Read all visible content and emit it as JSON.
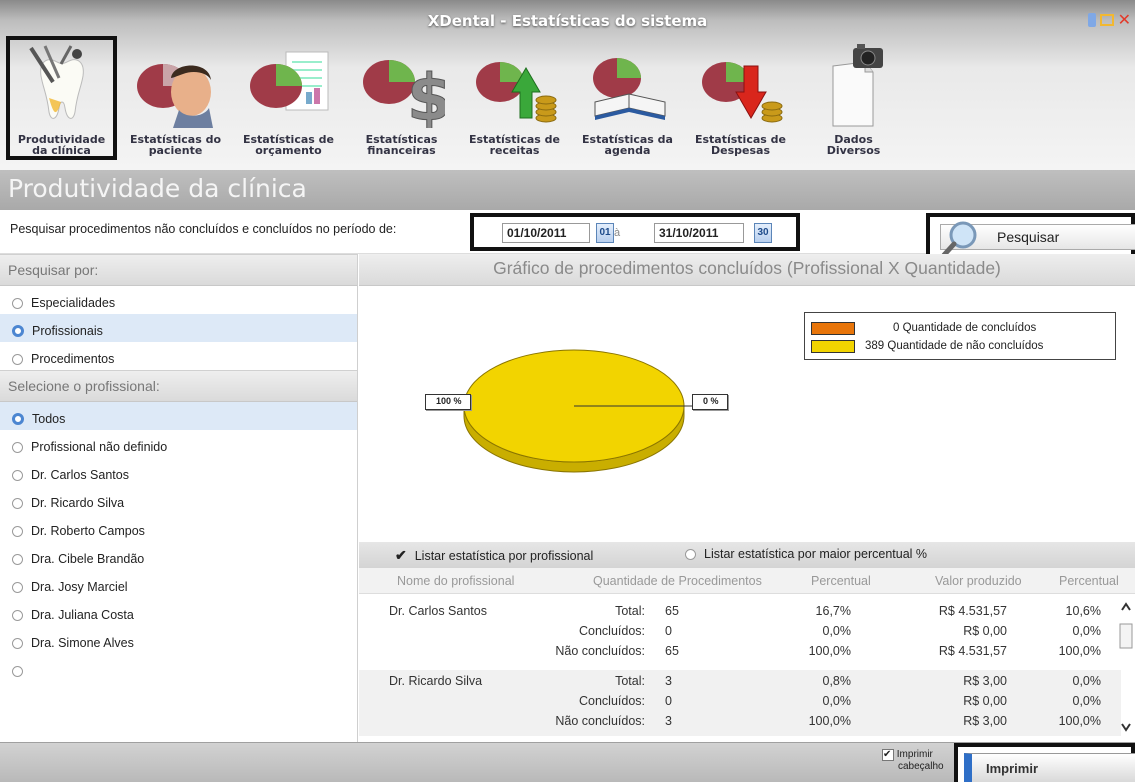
{
  "window": {
    "title": "XDental - Estatísticas do sistema"
  },
  "toolbar": {
    "items": [
      {
        "line1": "Produtividade",
        "line2": "da clínica",
        "icon": "tooth-dental-tools-icon",
        "active": true
      },
      {
        "line1": "Estatísticas do",
        "line2": "paciente",
        "icon": "patient-pie-icon",
        "active": false
      },
      {
        "line1": "Estatísticas de",
        "line2": "orçamento",
        "icon": "budget-pie-icon",
        "active": false
      },
      {
        "line1": "Estatísticas",
        "line2": "financeiras",
        "icon": "finance-dollar-icon",
        "active": false
      },
      {
        "line1": "Estatísticas de",
        "line2": "receitas",
        "icon": "revenue-arrow-up-icon",
        "active": false
      },
      {
        "line1": "Estatísticas da",
        "line2": "agenda",
        "icon": "agenda-book-icon",
        "active": false
      },
      {
        "line1": "Estatísticas de",
        "line2": "Despesas",
        "icon": "expenses-arrow-down-icon",
        "active": false
      },
      {
        "line1": "Dados",
        "line2": "Diversos",
        "icon": "document-camera-icon",
        "active": false
      }
    ]
  },
  "page": {
    "heading": "Produtividade da clínica"
  },
  "search": {
    "query_label": "Pesquisar procedimentos não concluídos e concluídos no período de:",
    "date_from": "01/10/2011",
    "date_from_btn": "01",
    "date_sep": "à",
    "date_to": "31/10/2011",
    "date_to_btn": "30",
    "button_label": "Pesquisar"
  },
  "filters": {
    "search_by_title": "Pesquisar por:",
    "search_by": [
      {
        "label": "Especialidades",
        "selected": false
      },
      {
        "label": "Profissionais",
        "selected": true
      },
      {
        "label": "Procedimentos",
        "selected": false
      }
    ],
    "professional_title": "Selecione o profissional:",
    "professionals": [
      {
        "label": "Todos",
        "selected": true
      },
      {
        "label": "Profissional não definido",
        "selected": false
      },
      {
        "label": "Dr. Carlos Santos",
        "selected": false
      },
      {
        "label": "Dr. Ricardo Silva",
        "selected": false
      },
      {
        "label": "Dr. Roberto Campos",
        "selected": false
      },
      {
        "label": "Dra. Cibele Brandão",
        "selected": false
      },
      {
        "label": "Dra. Josy Marciel",
        "selected": false
      },
      {
        "label": "Dra. Juliana Costa",
        "selected": false
      },
      {
        "label": "Dra. Simone Alves",
        "selected": false
      }
    ]
  },
  "chart_data": {
    "type": "pie",
    "title": "Gráfico de procedimentos concluídos (Profissional X Quantidade)",
    "slices": [
      {
        "label": "0 Quantidade de concluídos",
        "value": 0,
        "pct_label": "0 %",
        "color": "#e8750a"
      },
      {
        "label": "389 Quantidade de não concluídos",
        "value": 389,
        "pct_label": "100 %",
        "color": "#f2d400"
      }
    ],
    "legend_position": "top-right"
  },
  "list_options": {
    "by_professional": "Listar estatística por profissional",
    "by_percent": "Listar estatística por maior percentual %"
  },
  "table": {
    "columns": [
      "Nome do profissional",
      "Quantidade de Procedimentos",
      "Percentual",
      "Valor produzido",
      "Percentual"
    ],
    "groups": [
      {
        "name": "Dr. Carlos Santos",
        "rows": [
          {
            "label": "Total:",
            "qty": "65",
            "pct": "16,7%",
            "value": "R$ 4.531,57",
            "vpct": "10,6%"
          },
          {
            "label": "Concluídos:",
            "qty": "0",
            "pct": "0,0%",
            "value": "R$ 0,00",
            "vpct": "0,0%"
          },
          {
            "label": "Não concluídos:",
            "qty": "65",
            "pct": "100,0%",
            "value": "R$ 4.531,57",
            "vpct": "100,0%"
          }
        ]
      },
      {
        "name": "Dr. Ricardo Silva",
        "rows": [
          {
            "label": "Total:",
            "qty": "3",
            "pct": "0,8%",
            "value": "R$ 3,00",
            "vpct": "0,0%"
          },
          {
            "label": "Concluídos:",
            "qty": "0",
            "pct": "0,0%",
            "value": "R$ 0,00",
            "vpct": "0,0%"
          },
          {
            "label": "Não concluídos:",
            "qty": "3",
            "pct": "100,0%",
            "value": "R$ 3,00",
            "vpct": "100,0%"
          }
        ]
      }
    ]
  },
  "footer": {
    "print_header_line1": "Imprimir",
    "print_header_line2": "cabeçalho",
    "print_button": "Imprimir"
  }
}
